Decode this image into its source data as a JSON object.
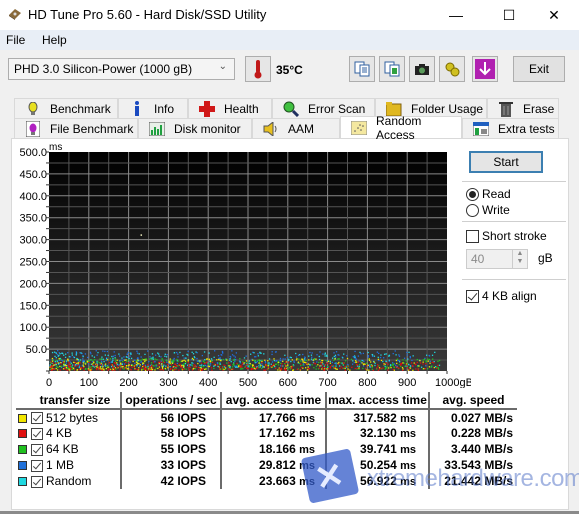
{
  "window": {
    "title": "HD Tune Pro 5.60 - Hard Disk/SSD Utility",
    "controls": {
      "minimize": "—",
      "maximize": "☐",
      "close": "✕"
    }
  },
  "menu": {
    "items": [
      "File",
      "Help"
    ]
  },
  "toolbar": {
    "drive_selected": "PHD 3.0 Silicon-Power (1000 gB)",
    "temperature": "35°C",
    "icons": [
      "copy-text-icon",
      "copy-screenshot-icon",
      "camera-icon",
      "options-icon",
      "save-download-icon"
    ],
    "exit_label": "Exit"
  },
  "tabs": {
    "row1": [
      {
        "label": "Benchmark",
        "icon": "lightbulb-icon"
      },
      {
        "label": "Info",
        "icon": "info-icon"
      },
      {
        "label": "Health",
        "icon": "health-cross-icon"
      },
      {
        "label": "Error Scan",
        "icon": "magnifier-icon"
      },
      {
        "label": "Folder Usage",
        "icon": "folder-icon"
      },
      {
        "label": "Erase",
        "icon": "trash-icon"
      }
    ],
    "row2": [
      {
        "label": "File Benchmark",
        "icon": "file-bulb-icon"
      },
      {
        "label": "Disk monitor",
        "icon": "monitor-chart-icon"
      },
      {
        "label": "AAM",
        "icon": "speaker-icon"
      },
      {
        "label": "Random Access",
        "icon": "scatter-icon",
        "active": true
      },
      {
        "label": "Extra tests",
        "icon": "extra-tests-icon"
      }
    ]
  },
  "side": {
    "start_label": "Start",
    "mode_options": [
      {
        "label": "Read",
        "selected": true
      },
      {
        "label": "Write",
        "selected": false
      }
    ],
    "short_stroke": {
      "label": "Short stroke",
      "checked": false
    },
    "short_stroke_value": "40",
    "short_stroke_unit": "gB",
    "align": {
      "label": "4 KB align",
      "checked": true
    }
  },
  "chart_data": {
    "type": "scatter",
    "title": "",
    "xlabel": "gB",
    "ylabel": "ms",
    "xlim": [
      0,
      1000
    ],
    "ylim": [
      0,
      500
    ],
    "x_ticks": [
      "0",
      "100",
      "200",
      "300",
      "400",
      "500",
      "600",
      "700",
      "800",
      "900",
      "1000gB"
    ],
    "y_ticks": [
      "500.0",
      "450.0",
      "400.0",
      "350.0",
      "300.0",
      "250.0",
      "200.0",
      "150.0",
      "100.0",
      "50.0"
    ],
    "grid": true,
    "series": [
      {
        "name": "512 bytes",
        "color": "#f0e800",
        "approx_range_ms": [
          3,
          30
        ],
        "outlier": {
          "x": 230,
          "y": 312
        }
      },
      {
        "name": "4 KB",
        "color": "#e01010",
        "approx_range_ms": [
          3,
          22
        ]
      },
      {
        "name": "64 KB",
        "color": "#20c020",
        "approx_range_ms": [
          5,
          30
        ]
      },
      {
        "name": "1 MB",
        "color": "#2070e0",
        "approx_range_ms": [
          12,
          48
        ]
      },
      {
        "name": "Random",
        "color": "#20d8e0",
        "approx_range_ms": [
          10,
          45
        ]
      }
    ]
  },
  "results": {
    "headers": [
      "transfer size",
      "operations / sec",
      "avg. access time",
      "max. access time",
      "avg. speed"
    ],
    "rows": [
      {
        "size": "512 bytes",
        "color": "#f2e600",
        "checked": true,
        "ops": "56 IOPS",
        "avg_access": "17.766",
        "max_access": "317.582",
        "speed": "0.027 MB/s"
      },
      {
        "size": "4 KB",
        "color": "#e01010",
        "checked": true,
        "ops": "58 IOPS",
        "avg_access": "17.162",
        "max_access": "32.130",
        "speed": "0.228 MB/s"
      },
      {
        "size": "64 KB",
        "color": "#20c020",
        "checked": true,
        "ops": "55 IOPS",
        "avg_access": "18.166",
        "max_access": "39.741",
        "speed": "3.440 MB/s"
      },
      {
        "size": "1 MB",
        "color": "#2070d8",
        "checked": true,
        "ops": "33 IOPS",
        "avg_access": "29.812",
        "max_access": "50.254",
        "speed": "33.543 MB/s"
      },
      {
        "size": "Random",
        "color": "#20d8e0",
        "checked": true,
        "ops": "42 IOPS",
        "avg_access": "23.663",
        "max_access": "56.922",
        "speed": "21.442 MB/s"
      }
    ],
    "unit_ms": "ms"
  },
  "watermark": {
    "text": "xtremehardware.com"
  }
}
